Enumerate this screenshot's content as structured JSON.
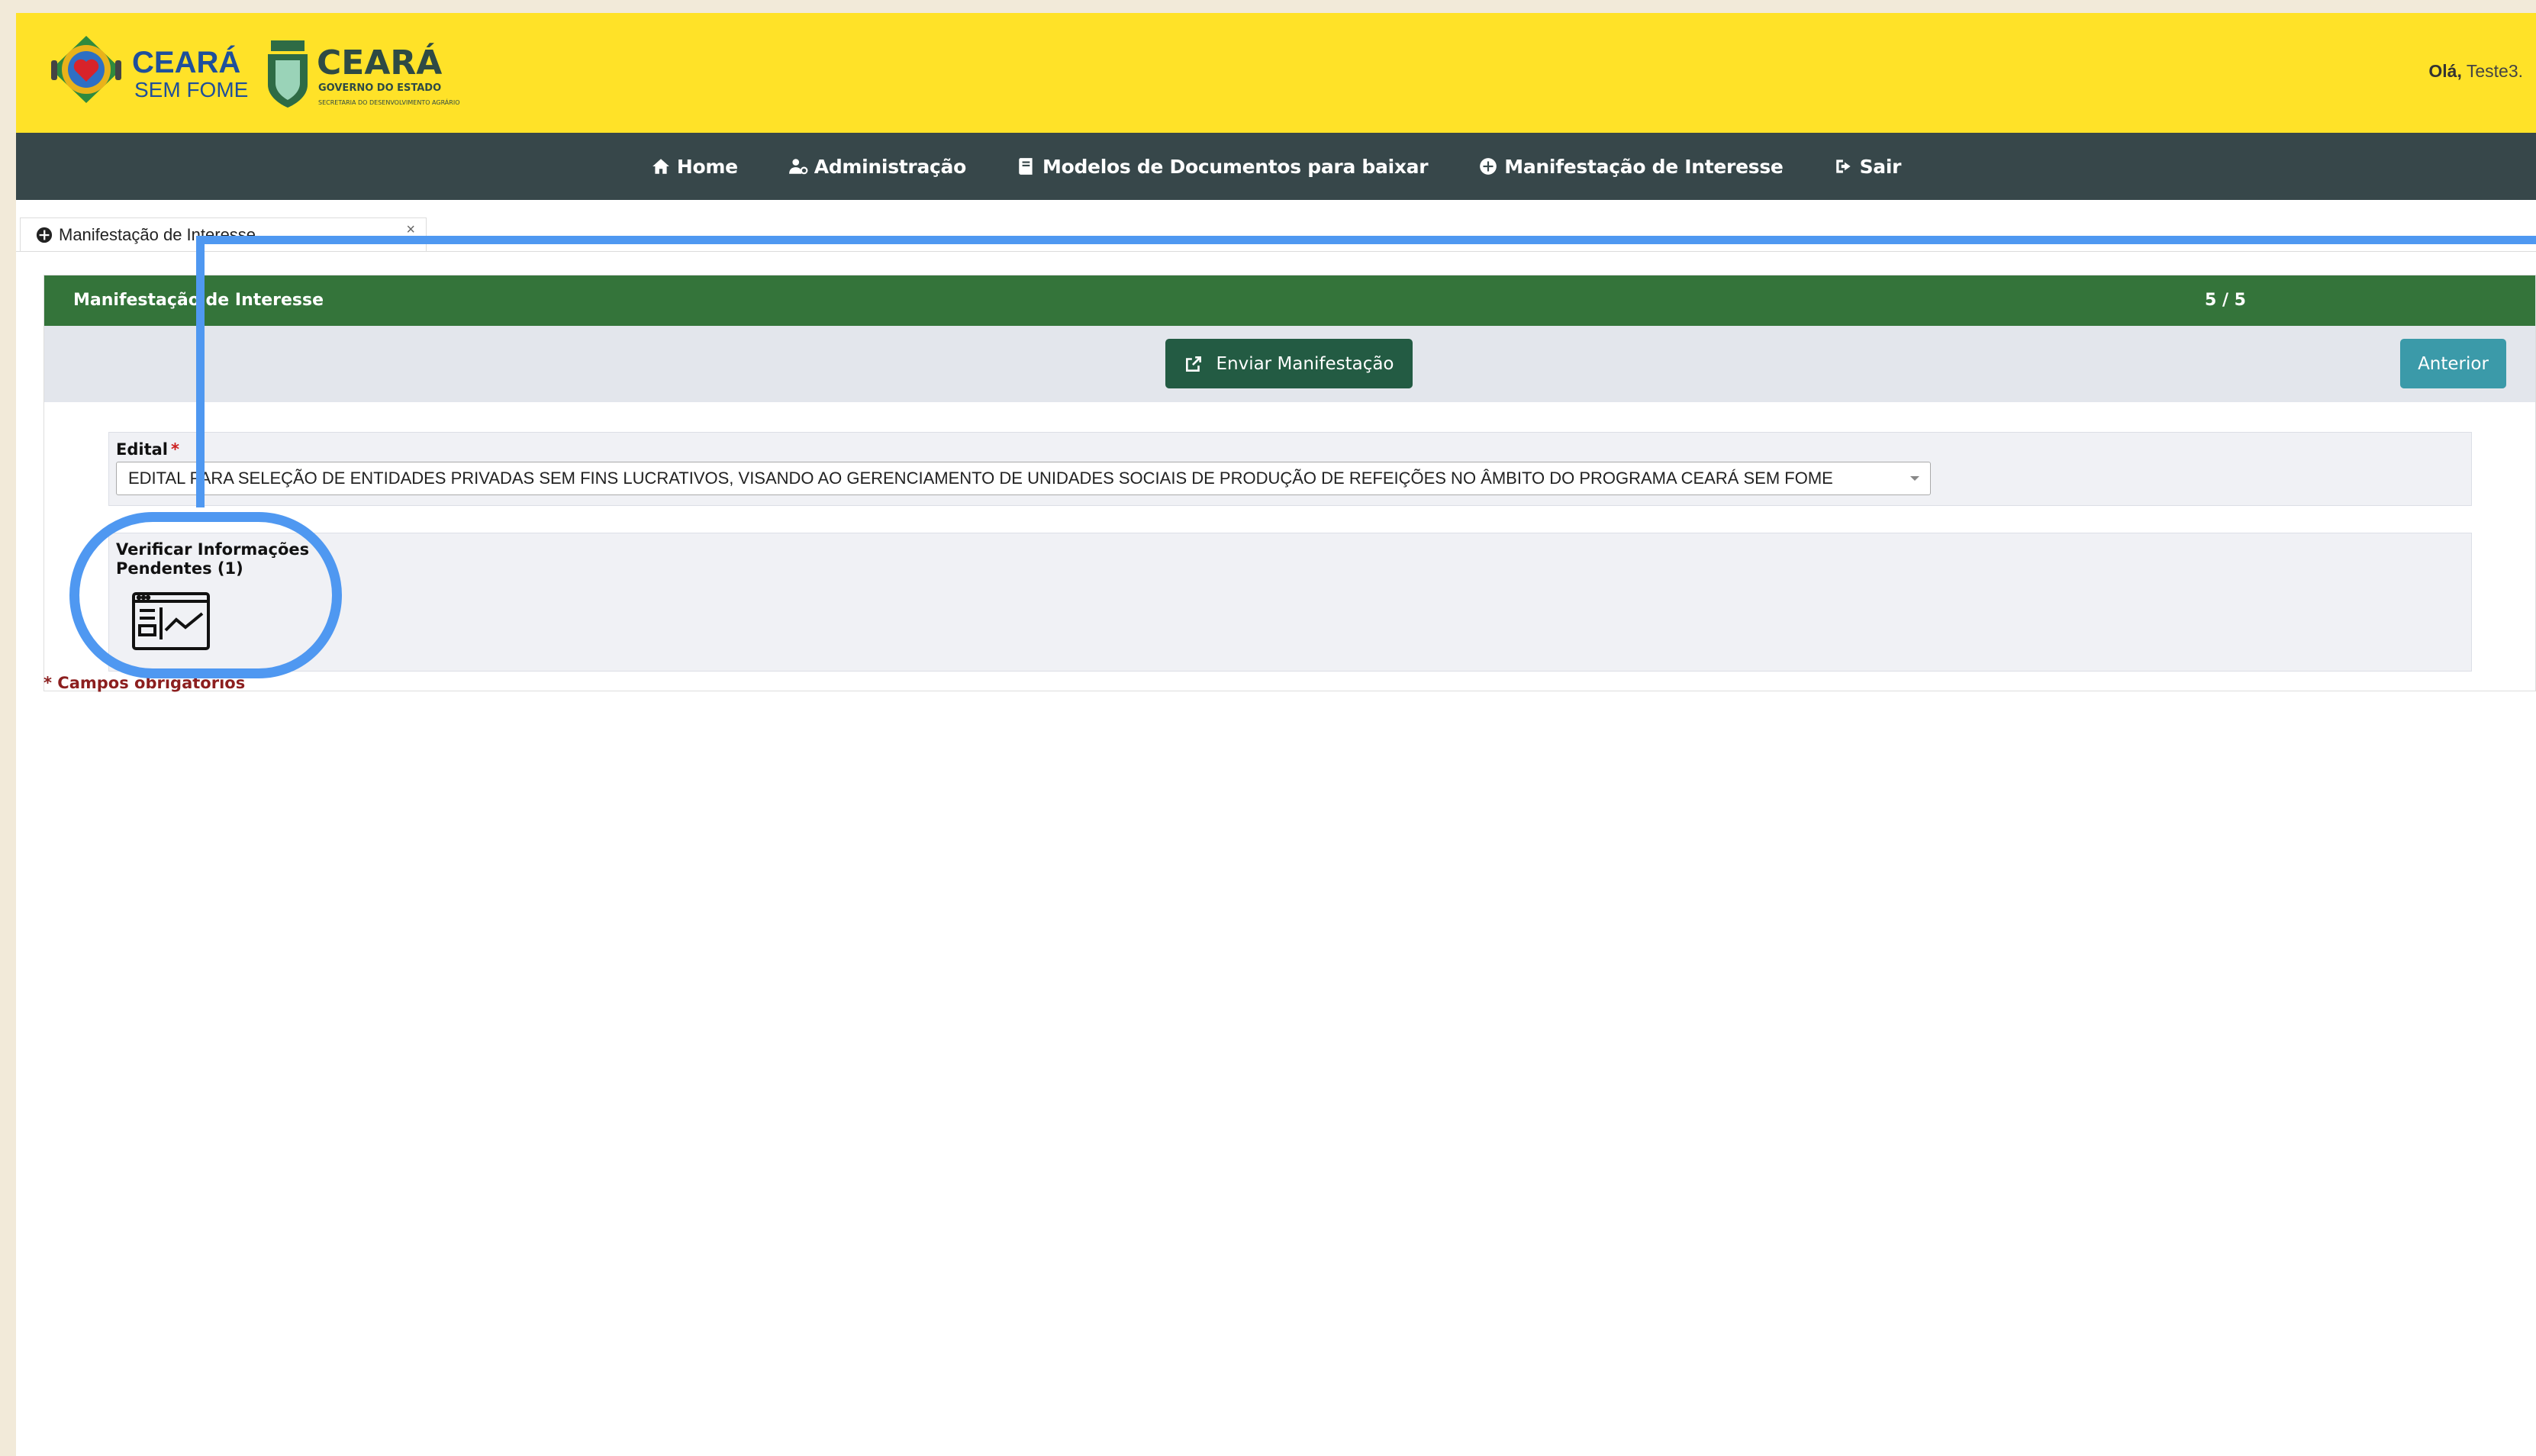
{
  "header": {
    "brand_primary": "CEARÁ",
    "brand_secondary": "SEM FOME",
    "gov_title": "CEARÁ",
    "gov_subtitle": "GOVERNO DO ESTADO",
    "gov_secretary": "SECRETARIA DO DESENVOLVIMENTO AGRÁRIO",
    "greeting_prefix": "Olá,",
    "user_name": "Teste3."
  },
  "nav": {
    "items": [
      {
        "label": "Home",
        "icon": "home-icon"
      },
      {
        "label": "Administração",
        "icon": "user-gear-icon"
      },
      {
        "label": "Modelos de Documentos para baixar",
        "icon": "book-icon"
      },
      {
        "label": "Manifestação de Interesse",
        "icon": "plus-circle-icon"
      },
      {
        "label": "Sair",
        "icon": "sign-out-icon"
      }
    ]
  },
  "tab": {
    "label": "Manifestação de Interesse",
    "close_symbol": "×"
  },
  "panel": {
    "title": "Manifestação de Interesse",
    "step": "5 / 5",
    "send_button": "Enviar Manifestação",
    "previous_button": "Anterior"
  },
  "edital": {
    "label": "Edital",
    "required_mark": "*",
    "value": "EDITAL PARA SELEÇÃO DE ENTIDADES PRIVADAS SEM FINS LUCRATIVOS, VISANDO AO GERENCIAMENTO DE UNIDADES SOCIAIS DE PRODUÇÃO DE REFEIÇÕES NO ÂMBITO DO PROGRAMA CEARÁ SEM FOME"
  },
  "pending": {
    "label": "Verificar Informações Pendentes (1)",
    "icon": "report-chart-icon"
  },
  "footer": {
    "required_note": "* Campos obrigatórios"
  },
  "colors": {
    "header_bg": "#ffe228",
    "nav_bg": "#37474a",
    "panel_header_bg": "#34743a",
    "send_button_bg": "#235b43",
    "previous_button_bg": "#3b9aa9",
    "annotation": "#4f98f1",
    "required": "#8c1f1f"
  }
}
